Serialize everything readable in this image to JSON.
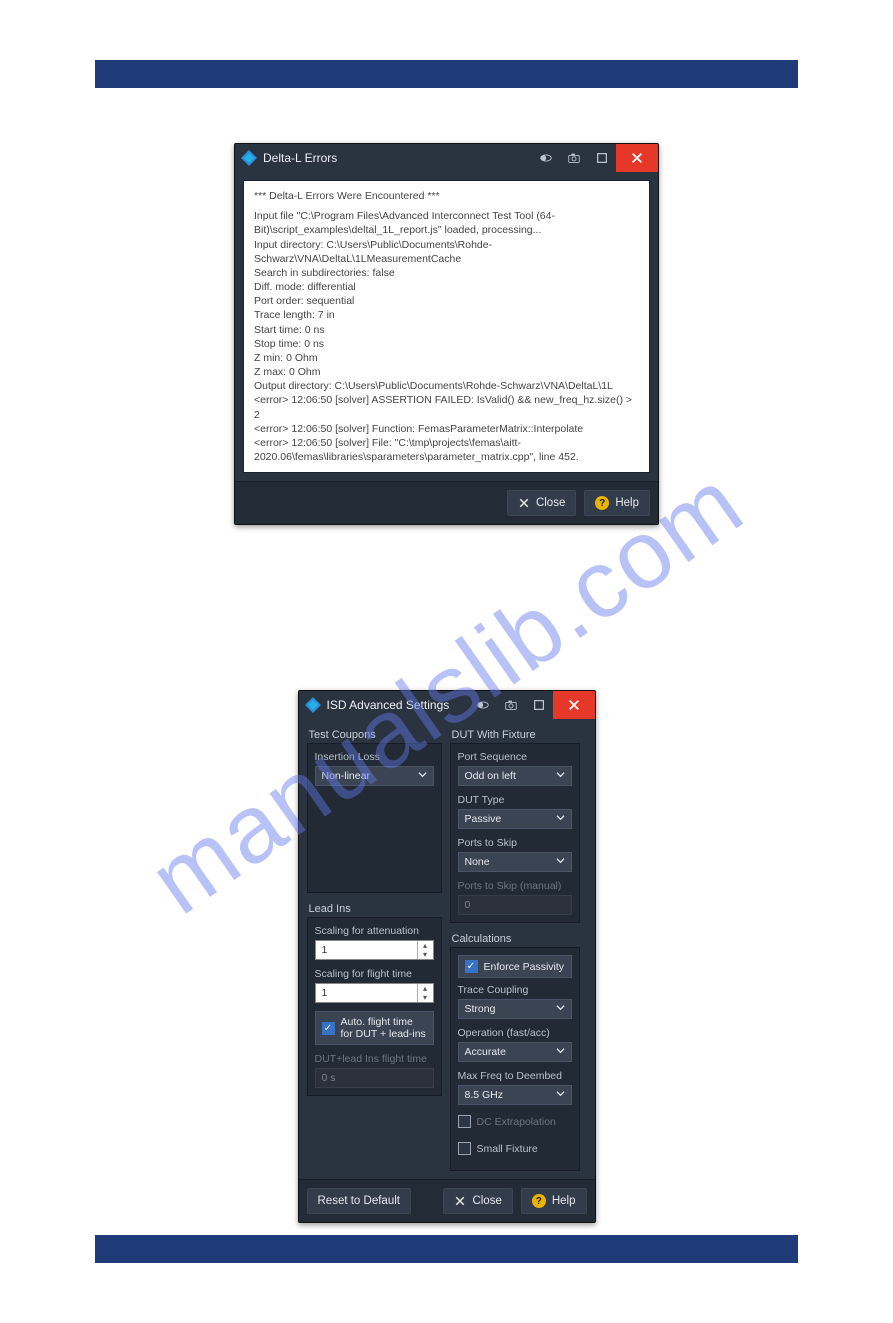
{
  "watermark": "manualslib.com",
  "dialog1": {
    "title": "Delta-L Errors",
    "header_line": "*** Delta-L Errors Were Encountered ***",
    "lines": [
      "Input file \"C:\\Program Files\\Advanced Interconnect Test Tool (64-Bit)\\script_examples\\deltal_1L_report.js\" loaded, processing...",
      "Input directory: C:\\Users\\Public\\Documents\\Rohde-Schwarz\\VNA\\DeltaL\\1LMeasurementCache",
      "Search in subdirectories: false",
      "Diff. mode: differential",
      "Port order: sequential",
      "Trace length: 7 in",
      "Start time: 0 ns",
      "Stop time: 0 ns",
      "Z min: 0 Ohm",
      "Z max: 0 Ohm",
      "Output directory: C:\\Users\\Public\\Documents\\Rohde-Schwarz\\VNA\\DeltaL\\1L",
      "<error> 12:06:50 [solver] ASSERTION FAILED: IsValid() && new_freq_hz.size() > 2",
      "<error> 12:06:50 [solver]     Function: FemasParameterMatrix::Interpolate",
      "<error> 12:06:50 [solver]     File: \"C:\\tmp\\projects\\femas\\aitt-2020.06\\femas\\libraries\\sparameters\\parameter_matrix.cpp\", line 452."
    ],
    "close": "Close",
    "help": "Help"
  },
  "dialog2": {
    "title": "ISD Advanced Settings",
    "sections": {
      "test_coupons": "Test Coupons",
      "dut_with_fixture": "DUT With Fixture",
      "lead_ins": "Lead Ins",
      "calculations": "Calculations"
    },
    "test_coupons": {
      "insertion_loss_label": "Insertion Loss",
      "insertion_loss_value": "Non-linear"
    },
    "dut": {
      "port_sequence_label": "Port Sequence",
      "port_sequence_value": "Odd on left",
      "dut_type_label": "DUT Type",
      "dut_type_value": "Passive",
      "ports_to_skip_label": "Ports to Skip",
      "ports_to_skip_value": "None",
      "ports_manual_label": "Ports to Skip (manual)",
      "ports_manual_value": "0"
    },
    "lead_ins": {
      "scale_att_label": "Scaling for attenuation",
      "scale_att_value": "1",
      "scale_flight_label": "Scaling for flight time",
      "scale_flight_value": "1",
      "auto_flight_label": "Auto. flight time for DUT + lead-ins",
      "dut_lead_time_label": "DUT+lead Ins flight time",
      "dut_lead_time_value": "0 s"
    },
    "calc": {
      "enforce_passivity": "Enforce Passivity",
      "trace_coupling_label": "Trace Coupling",
      "trace_coupling_value": "Strong",
      "operation_label": "Operation (fast/acc)",
      "operation_value": "Accurate",
      "max_freq_label": "Max Freq to Deembed",
      "max_freq_value": "8.5 GHz",
      "dc_extrap": "DC Extrapolation",
      "small_fixture": "Small Fixture"
    },
    "reset": "Reset to Default",
    "close": "Close",
    "help": "Help"
  }
}
